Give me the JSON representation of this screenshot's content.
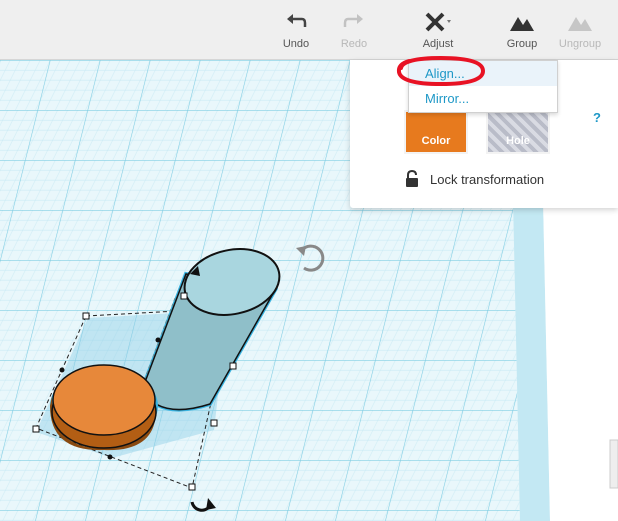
{
  "toolbar": {
    "undo_label": "Undo",
    "redo_label": "Redo",
    "adjust_label": "Adjust",
    "group_label": "Group",
    "ungroup_label": "Ungroup"
  },
  "adjust_menu": {
    "items": [
      {
        "label": "Align...",
        "selected": true
      },
      {
        "label": "Mirror...",
        "selected": false
      }
    ]
  },
  "inspector": {
    "color_label": "Color",
    "hole_label": "Hole",
    "help_label": "?",
    "lock_label": "Lock transformation"
  },
  "colors": {
    "accent": "#1e98c7",
    "shape_orange": "#e77a1e",
    "cylinder": "#a9d6df",
    "grid": "#9fd8ea",
    "annotation": "#e81224"
  },
  "icons": [
    "undo-icon",
    "redo-icon",
    "adjust-icon",
    "group-icon",
    "ungroup-icon",
    "lock-icon",
    "rotate-handle-icon"
  ]
}
